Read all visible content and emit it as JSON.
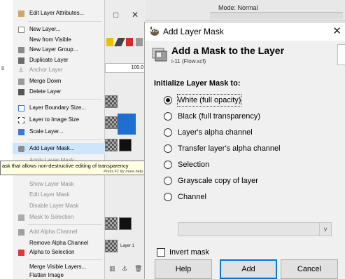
{
  "background": {
    "mode_label": "Mode: Normal",
    "opacity_value": "100.0",
    "layer_name": "Layer 1",
    "left_hint": "ti",
    "window_buttons": [
      "□",
      "✕"
    ]
  },
  "menu": {
    "items": [
      {
        "label": "Edit Layer Attributes...",
        "enabled": true
      },
      {
        "label": "New Layer...",
        "enabled": true
      },
      {
        "label": "New from Visible",
        "enabled": true
      },
      {
        "label": "New Layer Group...",
        "enabled": true
      },
      {
        "label": "Duplicate Layer",
        "enabled": true
      },
      {
        "label": "Anchor Layer",
        "enabled": false
      },
      {
        "label": "Merge Down",
        "enabled": true
      },
      {
        "label": "Delete Layer",
        "enabled": true
      },
      {
        "label": "Layer Boundary Size...",
        "enabled": true
      },
      {
        "label": "Layer to Image Size",
        "enabled": true
      },
      {
        "label": "Scale Layer...",
        "enabled": true
      },
      {
        "label": "Add Layer Mask...",
        "enabled": true
      },
      {
        "label": "Apply Layer Mask",
        "enabled": false
      },
      {
        "label": "Show Layer Mask",
        "enabled": false
      },
      {
        "label": "Edit Layer Mask",
        "enabled": false
      },
      {
        "label": "Disable Layer Mask",
        "enabled": false
      },
      {
        "label": "Mask to Selection",
        "enabled": false
      },
      {
        "label": "Add Alpha Channel",
        "enabled": false
      },
      {
        "label": "Remove Alpha Channel",
        "enabled": true
      },
      {
        "label": "Alpha to Selection",
        "enabled": true
      },
      {
        "label": "Merge Visible Layers...",
        "enabled": true
      },
      {
        "label": "Flatten Image",
        "enabled": true
      }
    ],
    "tooltip": {
      "text": "ask that allows non-destructive editing of transparency",
      "hint": "Press F1 for more help"
    }
  },
  "dialog": {
    "window_title": "Add Layer Mask",
    "header_title": "Add a Mask to the Layer",
    "header_subtitle": "i-11 (Flow.xcf)",
    "section_title": "Initialize Layer Mask to:",
    "options": [
      "White (full opacity)",
      "Black (full transparency)",
      "Layer's alpha channel",
      "Transfer layer's alpha channel",
      "Selection",
      "Grayscale copy of layer",
      "Channel"
    ],
    "selected_option": 0,
    "invert_label": "Invert mask",
    "buttons": {
      "help": "Help",
      "add": "Add",
      "cancel": "Cancel"
    }
  },
  "colors": {
    "highlight": "#cde6fb",
    "selected_layer": "#1e6fd0",
    "tooltip_bg": "#ffffe1",
    "default_button_border": "#0078d7"
  },
  "icons": [
    "gimp-wilber-icon",
    "close-icon",
    "layer-mask-icon",
    "chevron-down-icon"
  ]
}
